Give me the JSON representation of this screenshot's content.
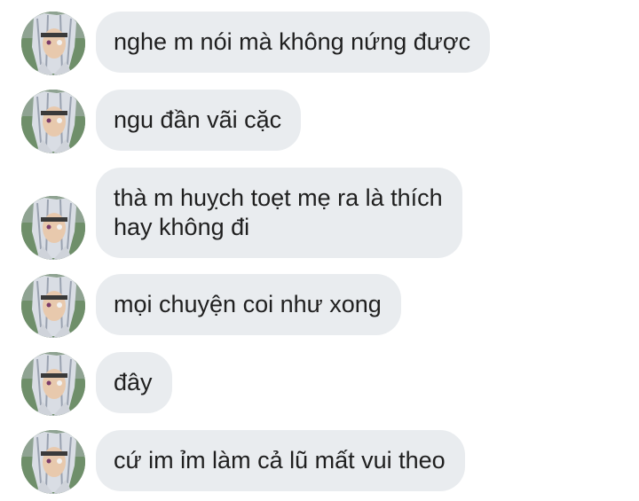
{
  "messages": [
    {
      "lines": [
        "nghe m nói mà không nứng được"
      ]
    },
    {
      "lines": [
        "ngu đần vãi cặc"
      ]
    },
    {
      "lines": [
        "thà m huỵch toẹt mẹ ra là thích",
        "hay không đi"
      ]
    },
    {
      "lines": [
        "mọi chuyện coi như xong"
      ]
    },
    {
      "lines": [
        "đây"
      ]
    },
    {
      "lines": [
        "cứ im ỉm làm cả lũ mất vui theo"
      ]
    }
  ],
  "colors": {
    "bubble_bg": "#e9ecef",
    "text": "#1f1f1f",
    "background": "#ffffff"
  },
  "icons": {
    "avatar": "anime-character-avatar"
  }
}
